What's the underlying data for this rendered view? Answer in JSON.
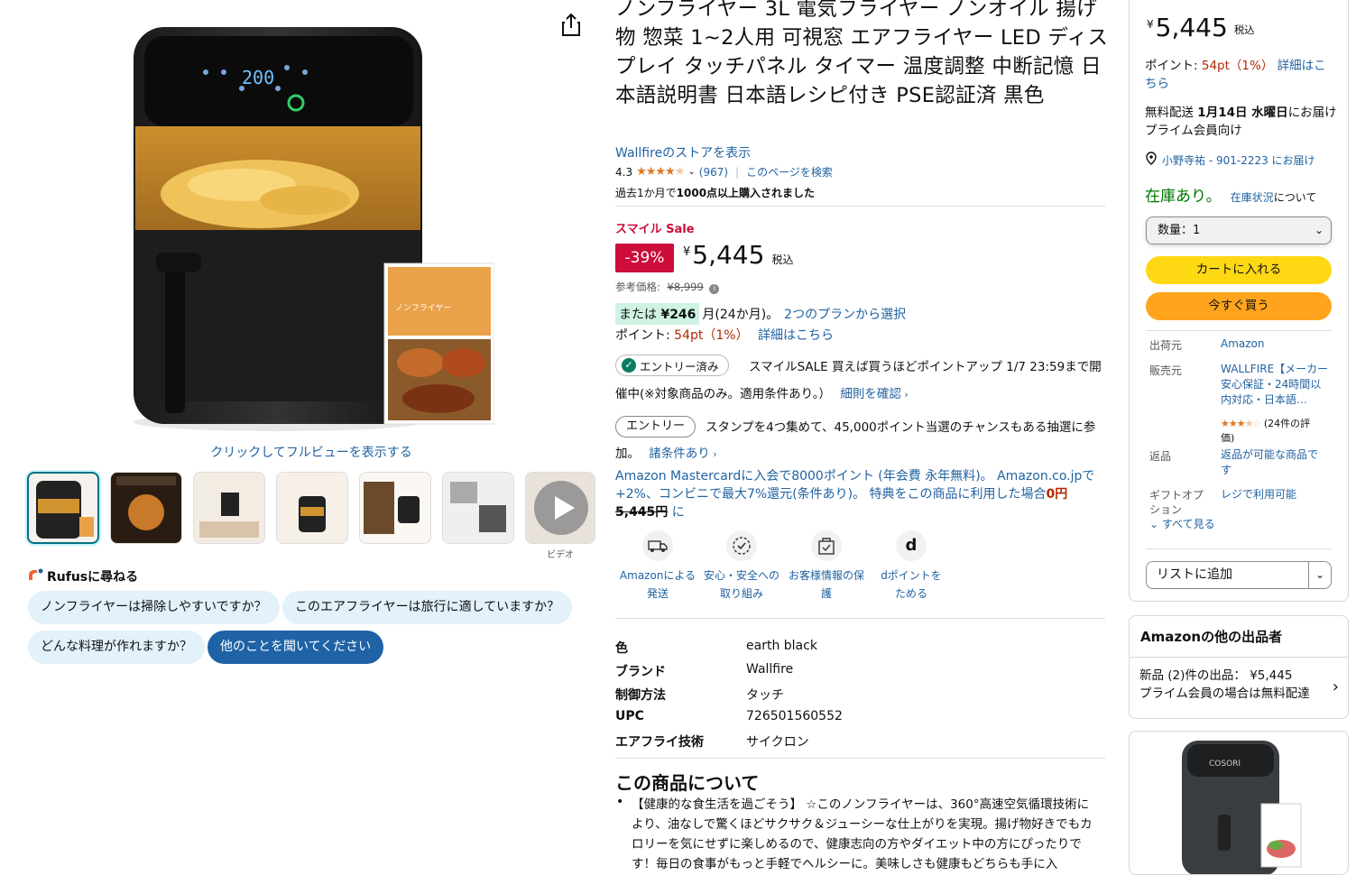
{
  "product": {
    "title": "ノンフライヤー 3L 電気フライヤー ノンオイル 揚げ物 惣菜 1~2人用 可視窓 エアフライヤー LED ディスプレイ タッチパネル タイマー 温度調整 中断記憶 日本語説明書 日本語レシピ付き PSE認証済 黒色",
    "store_link": "Wallfireのストアを表示",
    "rating": "4.3",
    "review_count": "(967)",
    "search_page": "このページを検索",
    "bought_prefix": "過去1か月で",
    "bought_bold": "1000点以上購入されました",
    "display_screen": "200",
    "book_title": "ノンフライヤー"
  },
  "gallery": {
    "fullview": "クリックしてフルビューを表示する",
    "video_label": "ビデオ"
  },
  "rufus": {
    "title": "Rufusに尋ねる",
    "chips": [
      "ノンフライヤーは掃除しやすいですか？",
      "このエアフライヤーは旅行に適していますか？",
      "どんな料理が作れますか？",
      "他のことを聞いてください"
    ]
  },
  "pricing": {
    "sale_label": "スマイル Sale",
    "discount": "-39%",
    "currency": "¥",
    "price": "5,445",
    "tax": "税込",
    "ref_label": "参考価格:",
    "ref_price": "¥8,999",
    "installment_prefix": "または",
    "installment_amount": "¥246",
    "installment_suffix": "月(24か月)。",
    "installment_link": "2つのプランから選択",
    "points_label": "ポイント:",
    "points_value": "54pt（1%）",
    "points_link": "詳細はこちら"
  },
  "promo": {
    "entry1_label": "エントリー済み",
    "smile_text": "スマイルSALE 買えば買うほどポイントアップ 1/7 23:59まで開催中(※対象商品のみ。適用条件あり。）",
    "smile_link": "細則を確認",
    "entry2_label": "エントリー",
    "stamp_text": "スタンプを4つ集めて、45,000ポイント当選のチャンスもある抽選に参加。",
    "stamp_link": "諸条件あり",
    "mc_text": "Amazon Mastercardに入会で8000ポイント (年会費 永年無料)。 Amazon.co.jpで+2%、コンビニで最大7%還元(条件あり)。 特典をこの商品に利用した場合",
    "mc_zero": "0円",
    "mc_strike": "5,445円",
    "mc_tail": " に"
  },
  "trust": [
    {
      "line1": "Amazonによる",
      "line2": "発送",
      "icon": "truck-icon"
    },
    {
      "line1": "安心・安全への",
      "line2": "取り組み",
      "icon": "shield-check-icon"
    },
    {
      "line1": "お客様情報の保",
      "line2": "護",
      "icon": "bag-lock-icon"
    },
    {
      "line1": "dポイントを",
      "line2": "ためる",
      "icon": "d-point-icon"
    }
  ],
  "specs": [
    {
      "key": "色",
      "value": "earth black"
    },
    {
      "key": "ブランド",
      "value": "Wallfire"
    },
    {
      "key": "制御方法",
      "value": "タッチ"
    },
    {
      "key": "UPC",
      "value": "726501560552"
    },
    {
      "key": "エアフライ技術",
      "value": "サイクロン"
    }
  ],
  "about": {
    "title": "この商品について",
    "bullet1": "【健康的な食生活を過ごそう】 ☆このノンフライヤーは、360°高速空気循環技術により、油なしで驚くほどサクサク＆ジューシーな仕上がりを実現。揚げ物好きでもカロリーを気にせずに楽しめるので、健康志向の方やダイエット中の方にぴったりです！毎日の食事がもっと手軽でヘルシーに。美味しさも健康もどちらも手に入"
  },
  "buybox": {
    "currency": "¥",
    "price": "5,445",
    "tax": "税込",
    "points_label": "ポイント:",
    "points_value": "54pt（1%）",
    "points_link": "詳細はこちら",
    "ship_prefix": "無料配送",
    "ship_date": "1月14日 水曜日",
    "ship_suffix": "にお届け プライム会員向け",
    "location": "小野寺祐 - 901-2223 にお届け",
    "stock": "在庫あり。",
    "stock_link": "在庫状況",
    "stock_suffix": "について",
    "qty": "数量：1",
    "cart_button": "カートに入れる",
    "buy_now": "今すぐ買う",
    "shipper_label": "出荷元",
    "shipper_value": "Amazon",
    "seller_label": "販売元",
    "seller_value": "WALLFIRE【メーカー安心保証・24時間以内対応・日本語…",
    "seller_rating": "(24件の評価)",
    "returns_label": "返品",
    "returns_value": "返品が可能な商品です",
    "gift_label": "ギフトオプション",
    "gift_value": "レジで利用可能",
    "see_all": "すべて見る",
    "list_button": "リストに追加",
    "accent": "#ffd814",
    "accent2": "#ffa41c"
  },
  "other_sellers": {
    "title": "Amazonの他の出品者",
    "line1": "新品 (2)件の出品：  ¥5,445",
    "line2": "プライム会員の場合は無料配達"
  },
  "ad": {
    "brand": "COSORI"
  }
}
